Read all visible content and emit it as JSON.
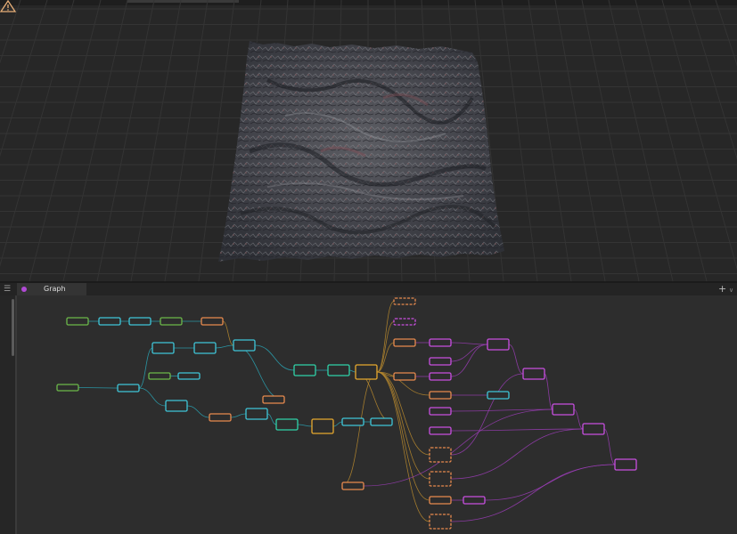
{
  "tabs": [
    {
      "label": "Graph",
      "active": true
    }
  ],
  "icons": {
    "menu": "hamburger-icon",
    "graph_tab": "graph-node-icon",
    "add": "plus-icon",
    "dropdown": "chevron-down-icon",
    "warning": "warning-icon"
  },
  "colors": {
    "viewport_bg": "#272727",
    "grid": "#343434",
    "graph_bg": "#2d2d2d",
    "node_green": "#6cb84a",
    "node_cyan": "#3fc6d8",
    "node_teal": "#30d2a8",
    "node_orange": "#e88a4e",
    "node_yellow": "#e6a82e",
    "node_magenta": "#c84fe0",
    "wire_cyan": "#2aa7b7",
    "wire_orange": "#b98a2e",
    "wire_magenta": "#9a3db5",
    "warning": "#e9b078"
  }
}
